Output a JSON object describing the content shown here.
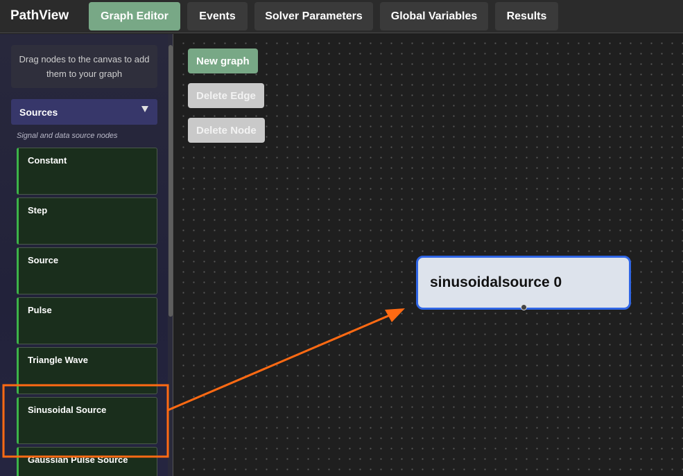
{
  "app": {
    "title": "PathView"
  },
  "tabs": [
    {
      "label": "Graph Editor",
      "active": true
    },
    {
      "label": "Events",
      "active": false
    },
    {
      "label": "Solver Parameters",
      "active": false
    },
    {
      "label": "Global Variables",
      "active": false
    },
    {
      "label": "Results",
      "active": false
    }
  ],
  "sidebar": {
    "hint": "Drag nodes to the canvas to add them to your graph",
    "section": {
      "title": "Sources",
      "description": "Signal and data source nodes",
      "expanded": true
    },
    "items": [
      {
        "label": "Constant"
      },
      {
        "label": "Step"
      },
      {
        "label": "Source"
      },
      {
        "label": "Pulse"
      },
      {
        "label": "Triangle Wave"
      },
      {
        "label": "Sinusoidal Source"
      },
      {
        "label": "Gaussian Pulse Source"
      }
    ]
  },
  "canvas": {
    "buttons": {
      "new_graph": "New graph",
      "delete_edge": "Delete Edge",
      "delete_node": "Delete Node"
    },
    "node": {
      "label": "sinusoidalsource 0"
    }
  },
  "colors": {
    "accent": "#78a886",
    "node_border": "#2f66e6",
    "annotation": "#ff6a13",
    "item_accent": "#3db34a"
  }
}
